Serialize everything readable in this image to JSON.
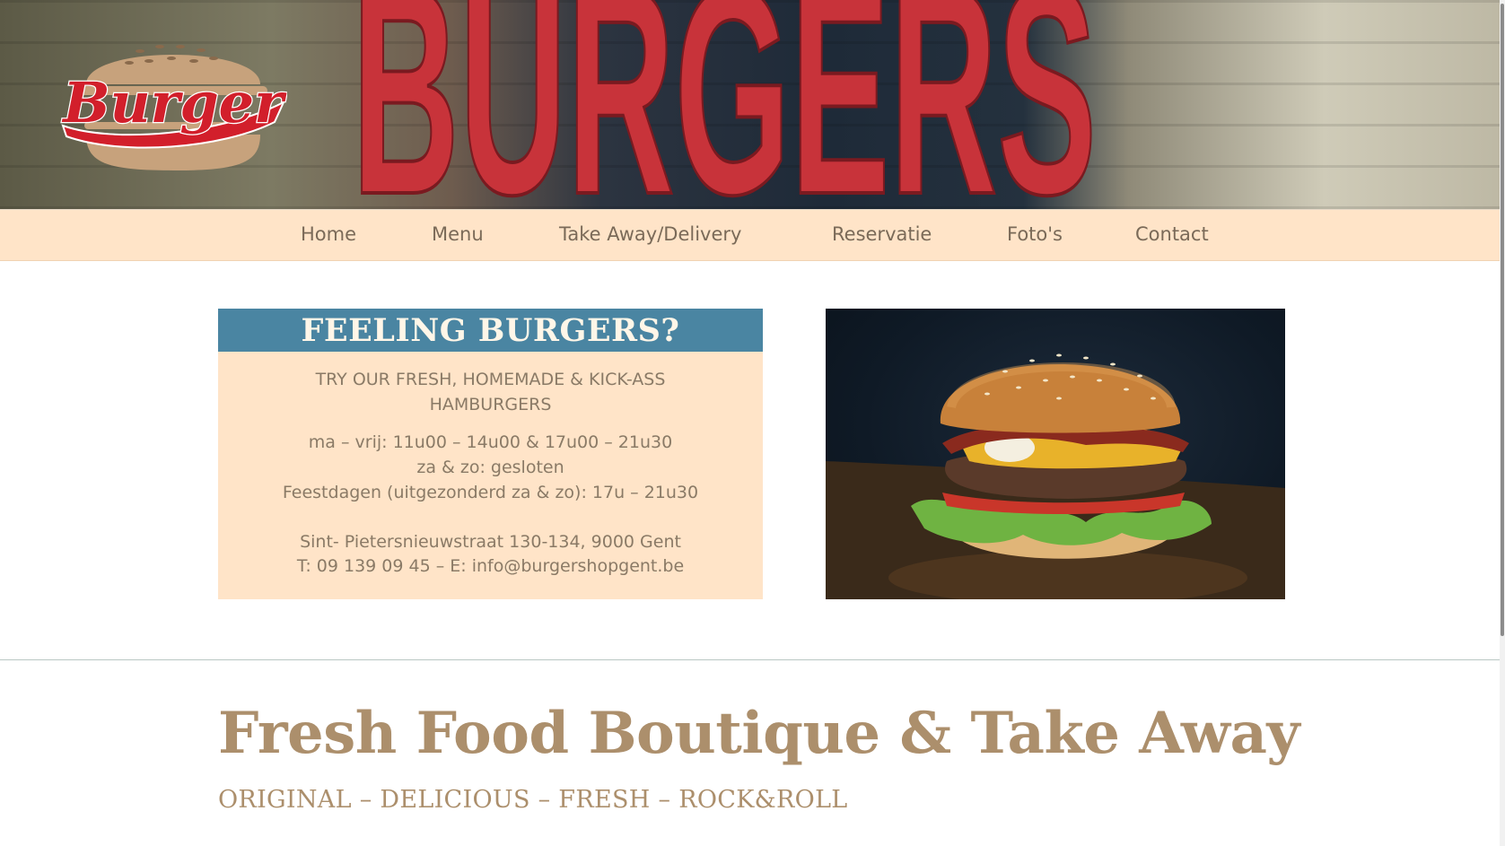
{
  "header": {
    "logo_text": "Burger",
    "sign_text": "BURGERS"
  },
  "nav": {
    "items": [
      {
        "label": "Home"
      },
      {
        "label": "Menu"
      },
      {
        "label": "Take Away/Delivery"
      },
      {
        "label": "Reservatie"
      },
      {
        "label": "Foto's"
      },
      {
        "label": "Contact"
      }
    ]
  },
  "info": {
    "heading": "FEELING BURGERS?",
    "tagline": "TRY OUR FRESH, HOMEMADE & KICK-ASS HAMBURGERS",
    "hours": [
      "ma – vrij: 11u00 – 14u00 & 17u00 – 21u30",
      "za & zo: gesloten",
      "Feestdagen (uitgezonderd za & zo): 17u – 21u30"
    ],
    "address": "Sint- Pietersnieuwstraat 130-134, 9000 Gent",
    "contact": "T: 09 139 09 45 – E: info@burgershopgent.be"
  },
  "main": {
    "title": "Fresh Food Boutique & Take Away",
    "subtitle": "ORIGINAL – DELICIOUS – FRESH – ROCK&ROLL"
  },
  "colors": {
    "accent_blue": "#4a85a2",
    "peach": "#ffe4c8",
    "brand_tan": "#ac8f6c",
    "logo_red": "#d21f2b"
  }
}
